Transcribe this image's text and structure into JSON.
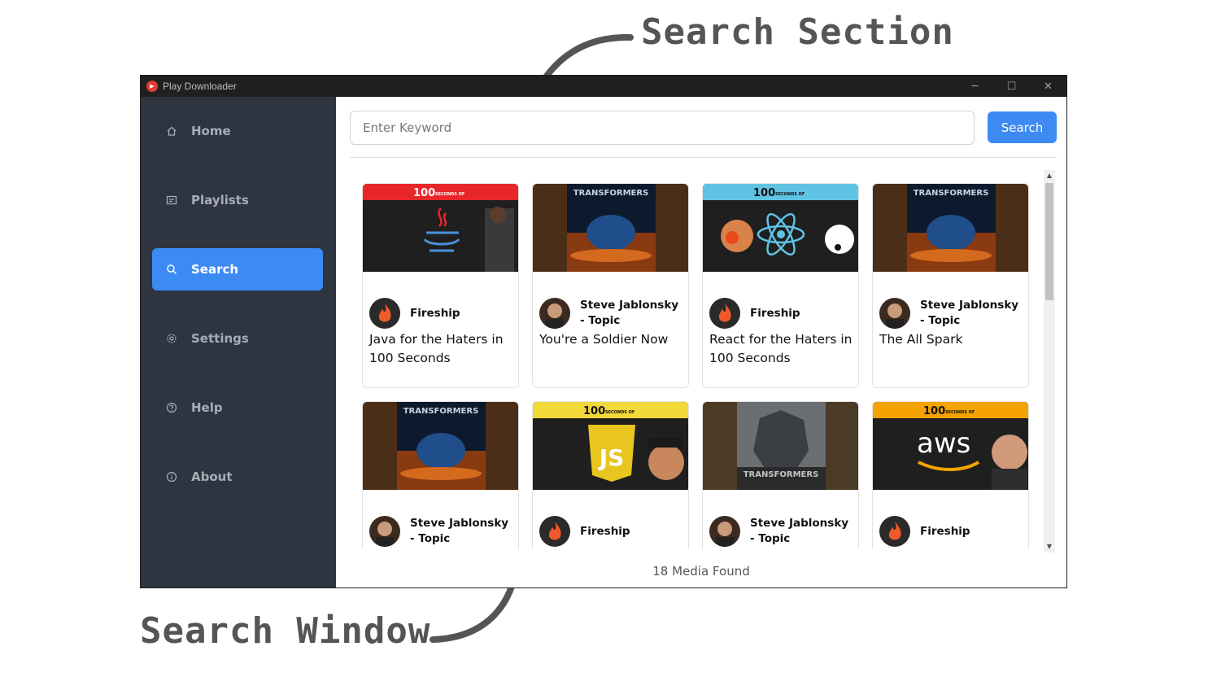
{
  "annotations": {
    "top": "Search Section",
    "bottom": "Search Window"
  },
  "window": {
    "title": "Play Downloader",
    "controls": {
      "minimize": "─",
      "maximize": "☐",
      "close": "✕"
    }
  },
  "sidebar": {
    "items": [
      {
        "label": "Home",
        "icon": "home-icon"
      },
      {
        "label": "Playlists",
        "icon": "playlist-icon"
      },
      {
        "label": "Search",
        "icon": "search-icon",
        "active": true
      },
      {
        "label": "Settings",
        "icon": "gear-icon"
      },
      {
        "label": "Help",
        "icon": "help-icon"
      },
      {
        "label": "About",
        "icon": "info-icon"
      }
    ]
  },
  "search": {
    "placeholder": "Enter Keyword",
    "value": "",
    "button": "Search"
  },
  "results": [
    {
      "channel": "Fireship",
      "title": "Java for the Haters in 100 Seconds",
      "thumb": "fireship-java",
      "avatar": "fireship"
    },
    {
      "channel": "Steve Jablonsky - Topic",
      "title": "You're a Soldier Now",
      "thumb": "transformers",
      "avatar": "steve"
    },
    {
      "channel": "Fireship",
      "title": "React for the Haters in 100 Seconds",
      "thumb": "fireship-react",
      "avatar": "fireship"
    },
    {
      "channel": "Steve Jablonsky - Topic",
      "title": "The All Spark",
      "thumb": "transformers",
      "avatar": "steve"
    },
    {
      "channel": "Steve Jablonsky - Topic",
      "title": "",
      "thumb": "transformers",
      "avatar": "steve"
    },
    {
      "channel": "Fireship",
      "title": "",
      "thumb": "fireship-js",
      "avatar": "fireship"
    },
    {
      "channel": "Steve Jablonsky - Topic",
      "title": "",
      "thumb": "transformers-aoe",
      "avatar": "steve"
    },
    {
      "channel": "Fireship",
      "title": "",
      "thumb": "fireship-aws",
      "avatar": "fireship"
    }
  ],
  "thumb_text": {
    "hundred": "100",
    "seconds_of": "SECONDS OF",
    "transformers": "TRANSFORMERS",
    "aws": "aws",
    "js": "JS"
  },
  "status": "18 Media Found",
  "colors": {
    "accent": "#3d8bf2",
    "sidebar_bg": "#2e3440",
    "fireship_red": "#e8262a",
    "react_blue": "#5fc3e4",
    "js_yellow": "#f2d93a",
    "aws_orange": "#f5a300"
  }
}
